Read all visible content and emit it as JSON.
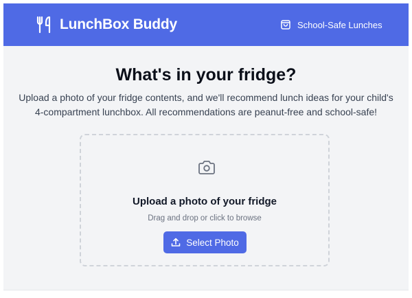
{
  "header": {
    "brand": "LunchBox Buddy",
    "brand_icon": "utensils-icon",
    "nav_link": "School-Safe Lunches",
    "nav_icon": "shopping-bag-icon",
    "background_color": "#4f6ae5"
  },
  "main": {
    "title": "What's in your fridge?",
    "subtitle": "Upload a photo of your fridge contents, and we'll recommend lunch ideas for your child's 4-compartment lunchbox. All recommendations are peanut-free and school-safe!"
  },
  "upload": {
    "icon": "camera-icon",
    "title": "Upload a photo of your fridge",
    "hint": "Drag and drop or click to browse",
    "button_label": "Select Photo",
    "button_icon": "upload-icon",
    "button_color": "#4f6ae5"
  }
}
